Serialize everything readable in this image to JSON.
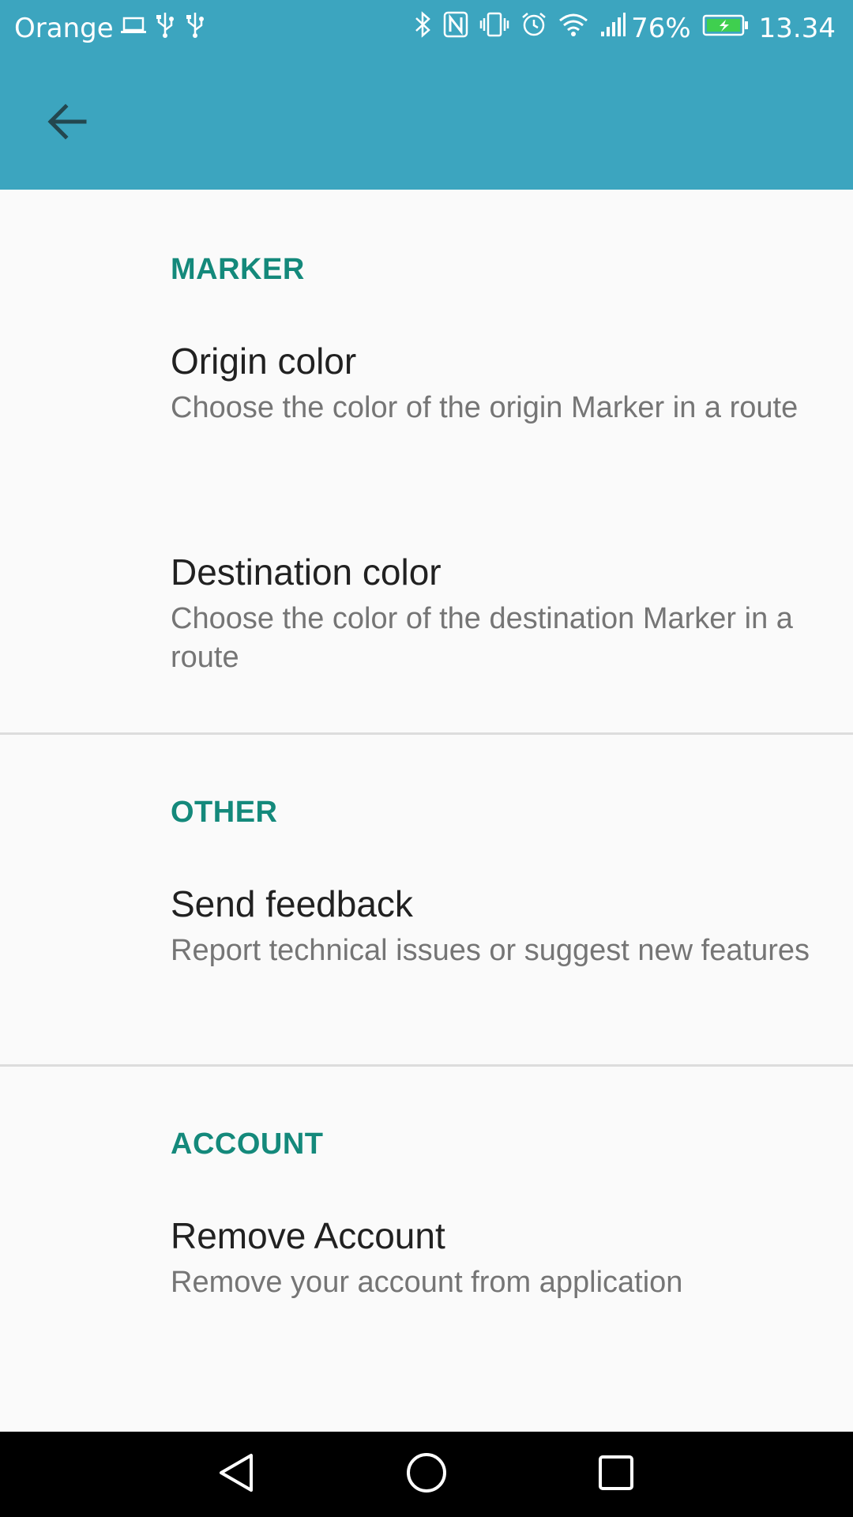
{
  "status_bar": {
    "carrier": "Orange",
    "battery_percent": "76%",
    "time": "13.34",
    "icons_left": [
      "laptop-icon",
      "usb-icon",
      "usb-icon"
    ],
    "icons_right": [
      "bluetooth-icon",
      "nfc-icon",
      "vibrate-icon",
      "alarm-icon",
      "wifi-icon",
      "signal-icon",
      "battery-charging-icon"
    ]
  },
  "app_bar": {
    "back_icon": "arrow-left-icon",
    "color": "#3ca5bf"
  },
  "sections": [
    {
      "header": "MARKER",
      "items": [
        {
          "title": "Origin color",
          "summary": "Choose the color of the origin Marker in a route"
        },
        {
          "title": "Destination color",
          "summary": "Choose the color of the destination Marker in a route"
        }
      ]
    },
    {
      "header": "OTHER",
      "items": [
        {
          "title": "Send feedback",
          "summary": "Report technical issues or suggest new features"
        }
      ]
    },
    {
      "header": "ACCOUNT",
      "items": [
        {
          "title": "Remove Account",
          "summary": "Remove your account from application"
        }
      ]
    }
  ],
  "nav_bar": {
    "buttons": [
      "back-triangle-icon",
      "home-circle-icon",
      "recents-square-icon"
    ]
  },
  "colors": {
    "accent": "#14897b",
    "primary": "#3ca5bf",
    "title_text": "#212121",
    "summary_text": "#757575",
    "background": "#fafafa"
  }
}
